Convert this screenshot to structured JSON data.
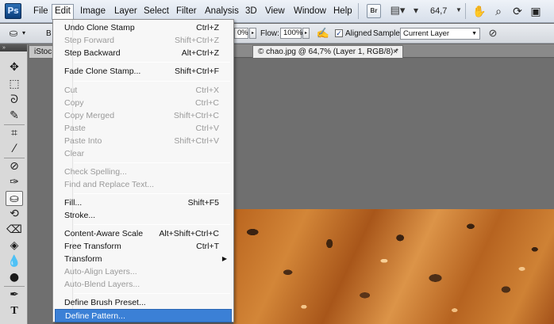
{
  "app": {
    "logo": "Ps"
  },
  "menubar": {
    "items": [
      "File",
      "Edit",
      "Image",
      "Layer",
      "Select",
      "Filter",
      "Analysis",
      "3D",
      "View",
      "Window",
      "Help"
    ],
    "bridge_label": "Br",
    "zoom": "64,7"
  },
  "options": {
    "tool_preset_label": "B",
    "opacity_value": "0%",
    "flow_label": "Flow:",
    "flow_value": "100%",
    "aligned_label": "Aligned",
    "aligned_checked": "✓",
    "sample_label": "Sample:",
    "sample_value": "Current Layer"
  },
  "tabs": [
    {
      "label": "iStoc"
    },
    {
      "label": "© chao.jpg @ 64,7% (Layer 1, RGB/8) *",
      "close": "×"
    }
  ],
  "edit_menu": {
    "groups": [
      [
        {
          "label": "Undo Clone Stamp",
          "shortcut": "Ctrl+Z",
          "enabled": true
        },
        {
          "label": "Step Forward",
          "shortcut": "Shift+Ctrl+Z",
          "enabled": false
        },
        {
          "label": "Step Backward",
          "shortcut": "Alt+Ctrl+Z",
          "enabled": true
        }
      ],
      [
        {
          "label": "Fade Clone Stamp...",
          "shortcut": "Shift+Ctrl+F",
          "enabled": true
        }
      ],
      [
        {
          "label": "Cut",
          "shortcut": "Ctrl+X",
          "enabled": false
        },
        {
          "label": "Copy",
          "shortcut": "Ctrl+C",
          "enabled": false
        },
        {
          "label": "Copy Merged",
          "shortcut": "Shift+Ctrl+C",
          "enabled": false
        },
        {
          "label": "Paste",
          "shortcut": "Ctrl+V",
          "enabled": false
        },
        {
          "label": "Paste Into",
          "shortcut": "Shift+Ctrl+V",
          "enabled": false
        },
        {
          "label": "Clear",
          "shortcut": "",
          "enabled": false
        }
      ],
      [
        {
          "label": "Check Spelling...",
          "shortcut": "",
          "enabled": false
        },
        {
          "label": "Find and Replace Text...",
          "shortcut": "",
          "enabled": false
        }
      ],
      [
        {
          "label": "Fill...",
          "shortcut": "Shift+F5",
          "enabled": true
        },
        {
          "label": "Stroke...",
          "shortcut": "",
          "enabled": true
        }
      ],
      [
        {
          "label": "Content-Aware Scale",
          "shortcut": "Alt+Shift+Ctrl+C",
          "enabled": true
        },
        {
          "label": "Free Transform",
          "shortcut": "Ctrl+T",
          "enabled": true
        },
        {
          "label": "Transform",
          "shortcut": "",
          "enabled": true,
          "submenu": "▶"
        },
        {
          "label": "Auto-Align Layers...",
          "shortcut": "",
          "enabled": false
        },
        {
          "label": "Auto-Blend Layers...",
          "shortcut": "",
          "enabled": false
        }
      ],
      [
        {
          "label": "Define Brush Preset...",
          "shortcut": "",
          "enabled": true
        },
        {
          "label": "Define Pattern...",
          "shortcut": "",
          "enabled": true,
          "highlighted": true
        }
      ]
    ]
  },
  "tools": [
    "move-tool-icon",
    "marquee-tool-icon",
    "lasso-tool-icon",
    "quick-selection-tool-icon",
    "crop-tool-icon",
    "eyedropper-tool-icon",
    "healing-brush-tool-icon",
    "brush-tool-icon",
    "clone-stamp-tool-icon",
    "history-brush-tool-icon",
    "eraser-tool-icon",
    "paint-bucket-tool-icon",
    "blur-tool-icon",
    "dodge-tool-icon",
    "pen-tool-icon",
    "type-tool-icon",
    "path-selection-tool-icon"
  ],
  "colors": {
    "highlight": "#3b80d6",
    "disabled_text": "#9a9a9a",
    "menubar_bg": "#e3e9f1"
  }
}
